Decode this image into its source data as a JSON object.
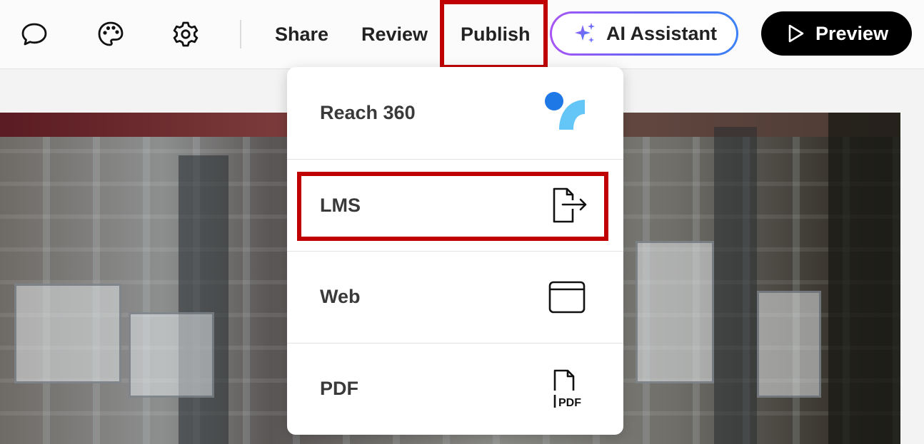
{
  "toolbar": {
    "icons": [
      "comment-icon",
      "palette-icon",
      "gear-icon"
    ],
    "share_label": "Share",
    "review_label": "Review",
    "publish_label": "Publish",
    "ai_assistant_label": "AI Assistant",
    "preview_label": "Preview"
  },
  "publish_menu": {
    "items": [
      {
        "label": "Reach 360",
        "icon": "reach-360-logo-icon"
      },
      {
        "label": "LMS",
        "icon": "file-export-icon"
      },
      {
        "label": "Web",
        "icon": "browser-window-icon"
      },
      {
        "label": "PDF",
        "icon": "pdf-file-icon",
        "icon_text": "PDF"
      }
    ]
  },
  "colors": {
    "highlight": "#c00000",
    "reach_blue": "#1e78e6",
    "reach_light_blue": "#63c6f7",
    "ai_gradient_start": "#a855f7",
    "ai_gradient_end": "#3b82f6",
    "preview_bg": "#000000"
  }
}
